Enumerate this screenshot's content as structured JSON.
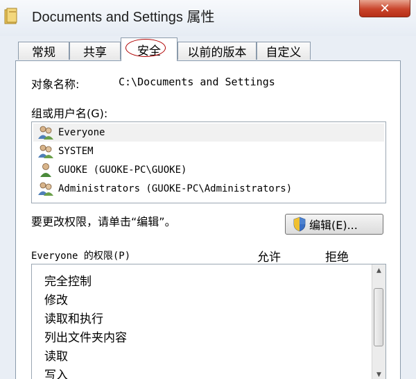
{
  "window": {
    "title": "Documents and Settings 属性",
    "close_glyph": "✕"
  },
  "tabs": [
    {
      "label": "常规"
    },
    {
      "label": "共享"
    },
    {
      "label": "安全"
    },
    {
      "label": "以前的版本"
    },
    {
      "label": "自定义"
    }
  ],
  "active_tab": "安全",
  "security": {
    "object_name_label": "对象名称:",
    "object_name_value": "C:\\Documents and Settings",
    "group_label": "组或用户名(G):",
    "users": [
      {
        "name": "Everyone",
        "icon": "group-users-icon"
      },
      {
        "name": "SYSTEM",
        "icon": "group-users-icon"
      },
      {
        "name": "GUOKE (GUOKE-PC\\GUOKE)",
        "icon": "user-icon"
      },
      {
        "name": "Administrators (GUOKE-PC\\Administrators)",
        "icon": "group-users-icon"
      }
    ],
    "hint": "要更改权限，请单击“编辑”。",
    "edit_button": "编辑(E)...",
    "permissions_label": "Everyone 的权限(P)",
    "allow_header": "允许",
    "deny_header": "拒绝",
    "permissions": [
      "完全控制",
      "修改",
      "读取和执行",
      "列出文件夹内容",
      "读取",
      "写入"
    ]
  },
  "colors": {
    "close_button": "#c9442b",
    "tab_highlight_circle": "#b00000",
    "window_frame": "#e9eef5"
  }
}
